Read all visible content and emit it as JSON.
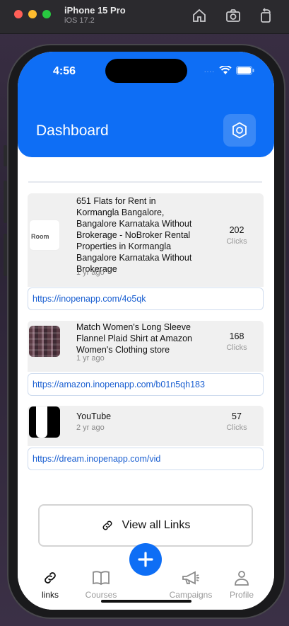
{
  "simulator": {
    "device": "iPhone 15 Pro",
    "os": "iOS 17.2"
  },
  "status": {
    "time": "4:56",
    "dots": "...."
  },
  "header": {
    "title": "Dashboard"
  },
  "links": [
    {
      "title_lines": [
        "651   Flats for Rent in",
        "Kormangla Bangalore,",
        "Bangalore Karnataka Without",
        "Brokerage - NoBroker Rental",
        "Properties in Kormangla",
        "Bangalore Karnataka Without",
        "Brokerage"
      ],
      "age": "1 yr ago",
      "clicks": "202",
      "clicks_label": "Clicks",
      "url": "https://inopenapp.com/4o5qk",
      "thumb_text": "Room"
    },
    {
      "title_lines": [
        "Match Women's Long Sleeve",
        "Flannel Plaid Shirt at Amazon",
        "Women's Clothing store"
      ],
      "age": "1 yr ago",
      "clicks": "168",
      "clicks_label": "Clicks",
      "url": "https://amazon.inopenapp.com/b01n5qh183"
    },
    {
      "title_lines": [
        "YouTube"
      ],
      "age": "2 yr ago",
      "clicks": "57",
      "clicks_label": "Clicks",
      "url": "https://dream.inopenapp.com/vid"
    }
  ],
  "view_all_label": "View all Links",
  "tabs": [
    {
      "label": "links",
      "icon": "link-icon",
      "active": true
    },
    {
      "label": "Courses",
      "icon": "book-icon",
      "active": false
    },
    {
      "label": "Campaigns",
      "icon": "megaphone-icon",
      "active": false
    },
    {
      "label": "Profile",
      "icon": "person-icon",
      "active": false
    }
  ],
  "colors": {
    "accent": "#0e6ef5",
    "link_text": "#1a5fd1"
  }
}
